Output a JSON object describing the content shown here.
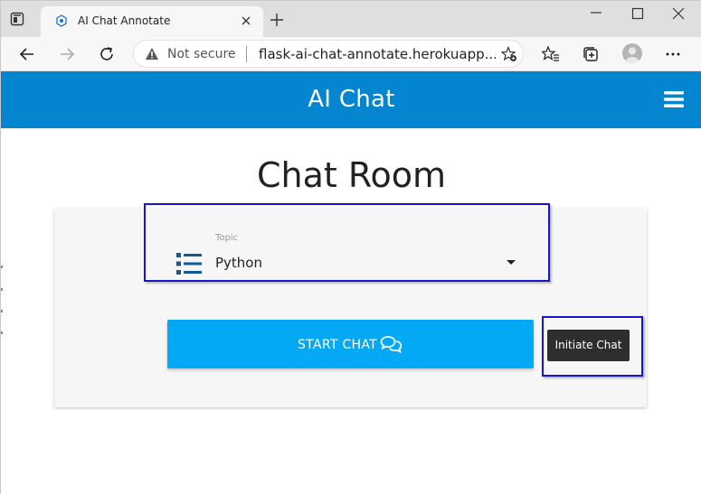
{
  "browser": {
    "tab_title": "AI Chat Annotate",
    "not_secure": "Not secure",
    "url": "flask-ai-chat-annotate.herokuapp...."
  },
  "app": {
    "brand": "AI Chat",
    "heading": "Chat Room",
    "topic_label": "Topic",
    "topic_value": "Python",
    "start_button": "START CHAT",
    "tooltip": "Initiate Chat"
  },
  "colors": {
    "appbar": "#0385cf",
    "start_button": "#03a9f4",
    "highlight": "#1616c8",
    "topic_icon": "#0d5a95"
  },
  "icons": [
    "tab-actions-icon",
    "favicon",
    "close-icon",
    "plus-icon",
    "minimize-icon",
    "maximize-icon",
    "window-close-icon",
    "back-icon",
    "forward-icon",
    "refresh-icon",
    "warning-icon",
    "favorite-add-icon",
    "favorites-icon",
    "collections-icon",
    "avatar",
    "more-icon",
    "hamburger-icon",
    "list-icon",
    "chat-icon"
  ]
}
